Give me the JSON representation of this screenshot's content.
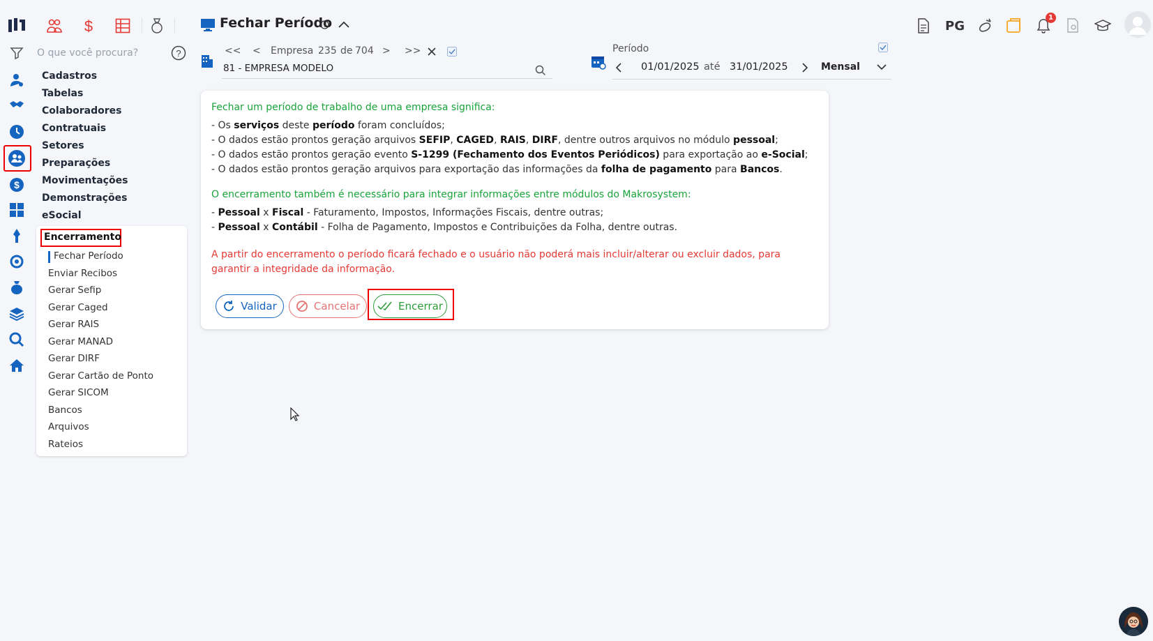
{
  "header": {
    "title": "Fechar Período",
    "nav": {
      "first": "<<",
      "prev": "<",
      "empresa_label": "Empresa",
      "empresa_current": "235",
      "de": "de",
      "empresa_total": "704",
      "next": ">",
      "last": ">>"
    },
    "company": "81 - EMPRESA MODELO",
    "period": {
      "label": "Período",
      "start": "01/01/2025",
      "ate": "até",
      "end": "31/01/2025",
      "type": "Mensal"
    },
    "top_right": {
      "pg_label": "PG",
      "notification_count": "1"
    }
  },
  "search": {
    "placeholder": "O que você procura?"
  },
  "sidebar": {
    "menu": [
      {
        "label": "Cadastros"
      },
      {
        "label": "Tabelas"
      },
      {
        "label": "Colaboradores"
      },
      {
        "label": "Contratuais"
      },
      {
        "label": "Setores"
      },
      {
        "label": "Preparações"
      },
      {
        "label": "Movimentações"
      },
      {
        "label": "Demonstrações"
      },
      {
        "label": "eSocial"
      }
    ],
    "submenu_title": "Encerramento",
    "submenu": [
      {
        "label": "Fechar Período"
      },
      {
        "label": "Enviar Recibos"
      },
      {
        "label": "Gerar Sefip"
      },
      {
        "label": "Gerar Caged"
      },
      {
        "label": "Gerar RAIS"
      },
      {
        "label": "Gerar MANAD"
      },
      {
        "label": "Gerar DIRF"
      },
      {
        "label": "Gerar Cartão de Ponto"
      },
      {
        "label": "Gerar SICOM"
      },
      {
        "label": "Bancos"
      },
      {
        "label": "Arquivos"
      },
      {
        "label": "Rateios"
      }
    ]
  },
  "card": {
    "intro": "Fechar um período de trabalho de uma empresa significa:",
    "l1": {
      "a": "- Os ",
      "b": "serviços",
      "c": " deste ",
      "d": "período",
      "e": " foram concluídos;"
    },
    "l2": {
      "a": "- O dados estão prontos geração arquivos ",
      "b": "SEFIP",
      "c": ", ",
      "d": "CAGED",
      "e": ", ",
      "f": "RAIS",
      "g": ", ",
      "h": "DIRF",
      "i": ", dentre outros arquivos no módulo ",
      "j": "pessoal",
      "k": ";"
    },
    "l3": {
      "a": "- O dados estão prontos geração evento ",
      "b": "S-1299 (Fechamento dos Eventos Periódicos)",
      "c": " para exportação ao ",
      "d": "e-Social",
      "e": ";"
    },
    "l4": {
      "a": "- O dados estão prontos geração arquivos para exportação das informações da ",
      "b": "folha de pagamento",
      "c": " para ",
      "d": "Bancos",
      "e": "."
    },
    "intro2": "O encerramento também é necessário para integrar informações entre módulos do Makrosystem:",
    "l5": {
      "a": "- ",
      "b": "Pessoal",
      "c": " x ",
      "d": "Fiscal",
      "e": " - Faturamento, Impostos, Informações Fiscais, dentre outras;"
    },
    "l6": {
      "a": "- ",
      "b": "Pessoal",
      "c": " x ",
      "d": "Contábil",
      "e": " - Folha de Pagamento, Impostos e Contribuições da Folha, dentre outras."
    },
    "warning": "A partir do encerramento o período ficará fechado e o usuário não poderá mais incluir/alterar ou excluir dados, para garantir a integridade da informação.",
    "buttons": {
      "validar": "Validar",
      "cancelar": "Cancelar",
      "encerrar": "Encerrar"
    }
  },
  "colors": {
    "accent": "#1565c0",
    "green": "#1aa33a",
    "red": "#e53935",
    "highlight": "#ee0000"
  }
}
